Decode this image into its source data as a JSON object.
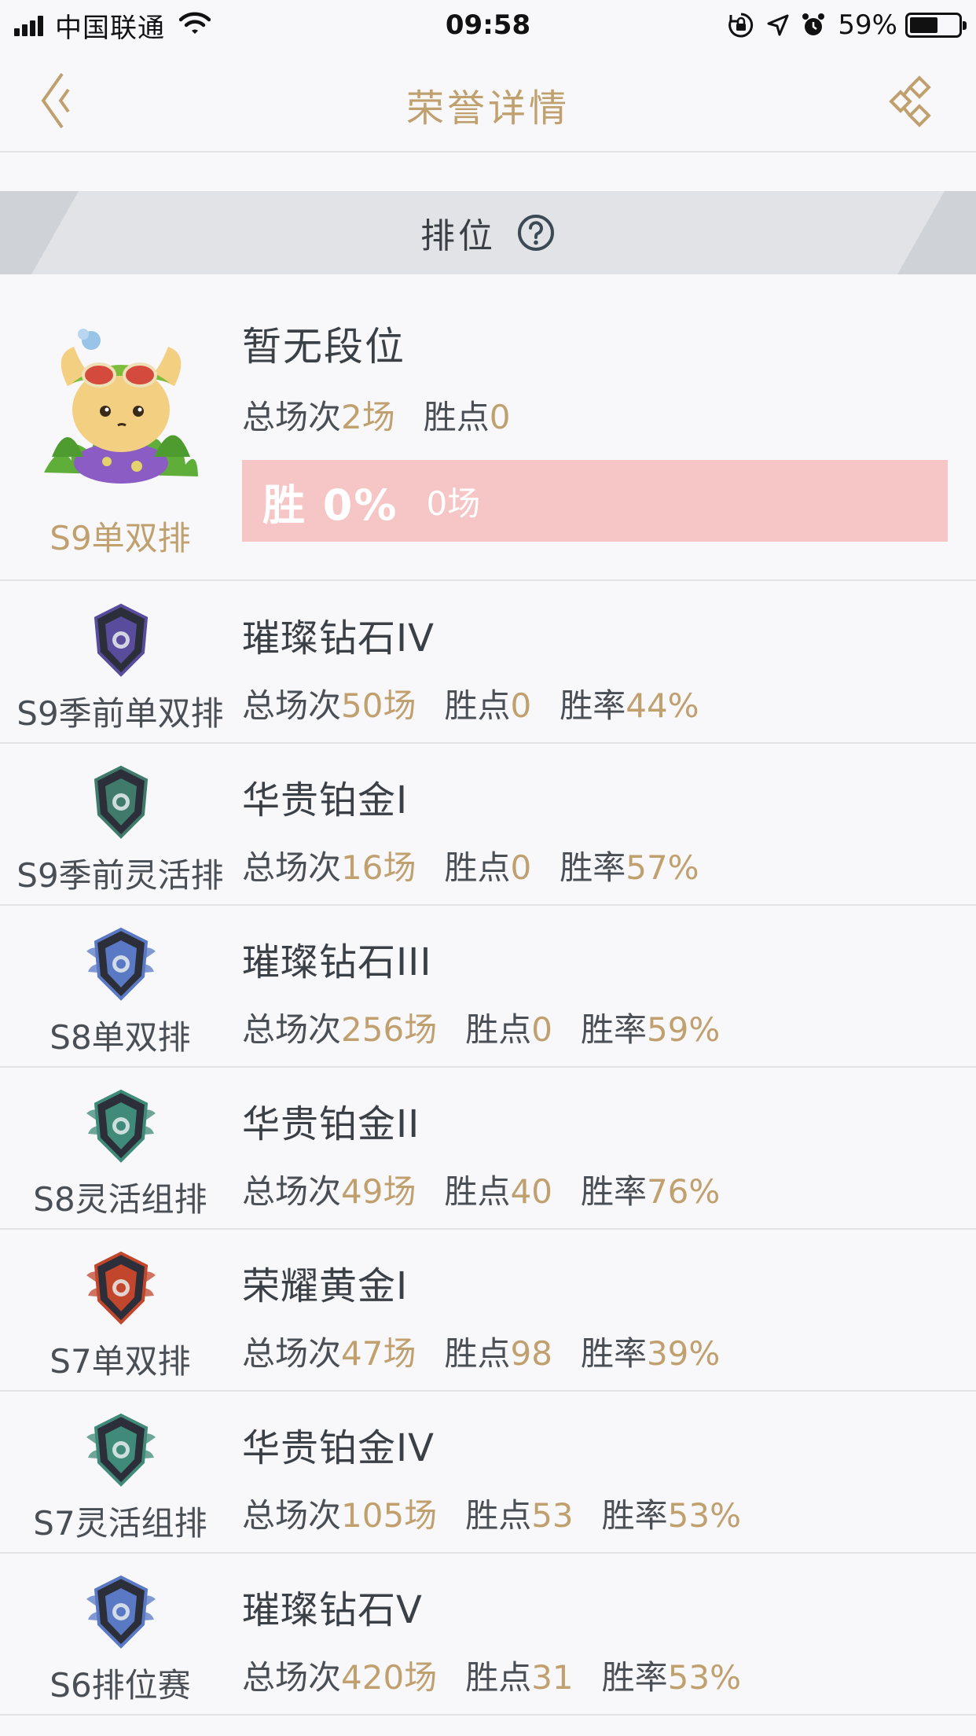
{
  "status_bar": {
    "carrier": "中国联通",
    "time": "09:58",
    "battery": "59%",
    "battery_level": 0.59
  },
  "nav": {
    "title": "荣誉详情",
    "back_icon": "chevron-left-icon",
    "share_icon": "share-icon"
  },
  "section": {
    "title": "排位",
    "help_icon": "question-circle-icon"
  },
  "current": {
    "rank": "暂无段位",
    "season": "S9单双排",
    "total_label": "总场次",
    "total_value": "2场",
    "points_label": "胜点",
    "points_value": "0",
    "win_label": "胜 0%",
    "win_games": "0场",
    "win_rate": 0
  },
  "history": [
    {
      "rank": "璀璨钻石IV",
      "season": "S9季前单双排",
      "total_label": "总场次",
      "total_value": "50场",
      "points_label": "胜点",
      "points_value": "0",
      "rate_label": "胜率",
      "rate_value": "44%",
      "emblem": "diamond-dark-emblem",
      "emblem_color": "#5a4c9c"
    },
    {
      "rank": "华贵铂金I",
      "season": "S9季前灵活排",
      "total_label": "总场次",
      "total_value": "16场",
      "points_label": "胜点",
      "points_value": "0",
      "rate_label": "胜率",
      "rate_value": "57%",
      "emblem": "platinum-dark-emblem",
      "emblem_color": "#3f7a6a"
    },
    {
      "rank": "璀璨钻石III",
      "season": "S8单双排",
      "total_label": "总场次",
      "total_value": "256场",
      "points_label": "胜点",
      "points_value": "0",
      "rate_label": "胜率",
      "rate_value": "59%",
      "emblem": "diamond-winged-emblem",
      "emblem_color": "#5a79c4"
    },
    {
      "rank": "华贵铂金II",
      "season": "S8灵活组排",
      "total_label": "总场次",
      "total_value": "49场",
      "points_label": "胜点",
      "points_value": "40",
      "rate_label": "胜率",
      "rate_value": "76%",
      "emblem": "platinum-emblem",
      "emblem_color": "#3f8a78"
    },
    {
      "rank": "荣耀黄金I",
      "season": "S7单双排",
      "total_label": "总场次",
      "total_value": "47场",
      "points_label": "胜点",
      "points_value": "98",
      "rate_label": "胜率",
      "rate_value": "39%",
      "emblem": "gold-emblem",
      "emblem_color": "#c2462c"
    },
    {
      "rank": "华贵铂金IV",
      "season": "S7灵活组排",
      "total_label": "总场次",
      "total_value": "105场",
      "points_label": "胜点",
      "points_value": "53",
      "rate_label": "胜率",
      "rate_value": "53%",
      "emblem": "platinum-emblem",
      "emblem_color": "#3f8a78"
    },
    {
      "rank": "璀璨钻石V",
      "season": "S6排位赛",
      "total_label": "总场次",
      "total_value": "420场",
      "points_label": "胜点",
      "points_value": "31",
      "rate_label": "胜率",
      "rate_value": "53%",
      "emblem": "diamond-winged-emblem",
      "emblem_color": "#5a79c4"
    }
  ],
  "colors": {
    "accent_gold": "#c0a06f",
    "text_dark": "#3b3f46",
    "winbar_bg": "#f6c5c6"
  }
}
